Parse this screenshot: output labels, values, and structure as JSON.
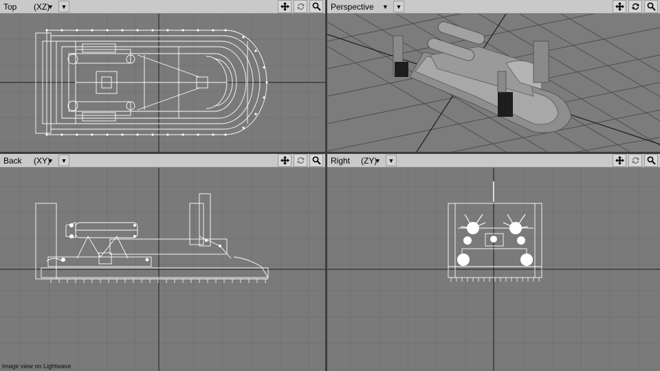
{
  "viewports": {
    "top": {
      "name": "Top",
      "axes": "(XZ)"
    },
    "perspective": {
      "name": "Perspective",
      "axes": ""
    },
    "back": {
      "name": "Back",
      "axes": "(XY)"
    },
    "right": {
      "name": "Right",
      "axes": "(ZY)"
    }
  },
  "icons": {
    "dropdown": "chevron-down-icon",
    "move": "move-icon",
    "rotate": "rotate-icon",
    "zoom": "magnifier-icon"
  },
  "colors": {
    "viewport_bg": "#7a7a7a",
    "grid": "#6a6a6a",
    "axis": "#1c1c1c",
    "wireframe": "#ffffff",
    "header": "#c9c9c9"
  },
  "footer": {
    "text": "image view on Lightwave"
  }
}
